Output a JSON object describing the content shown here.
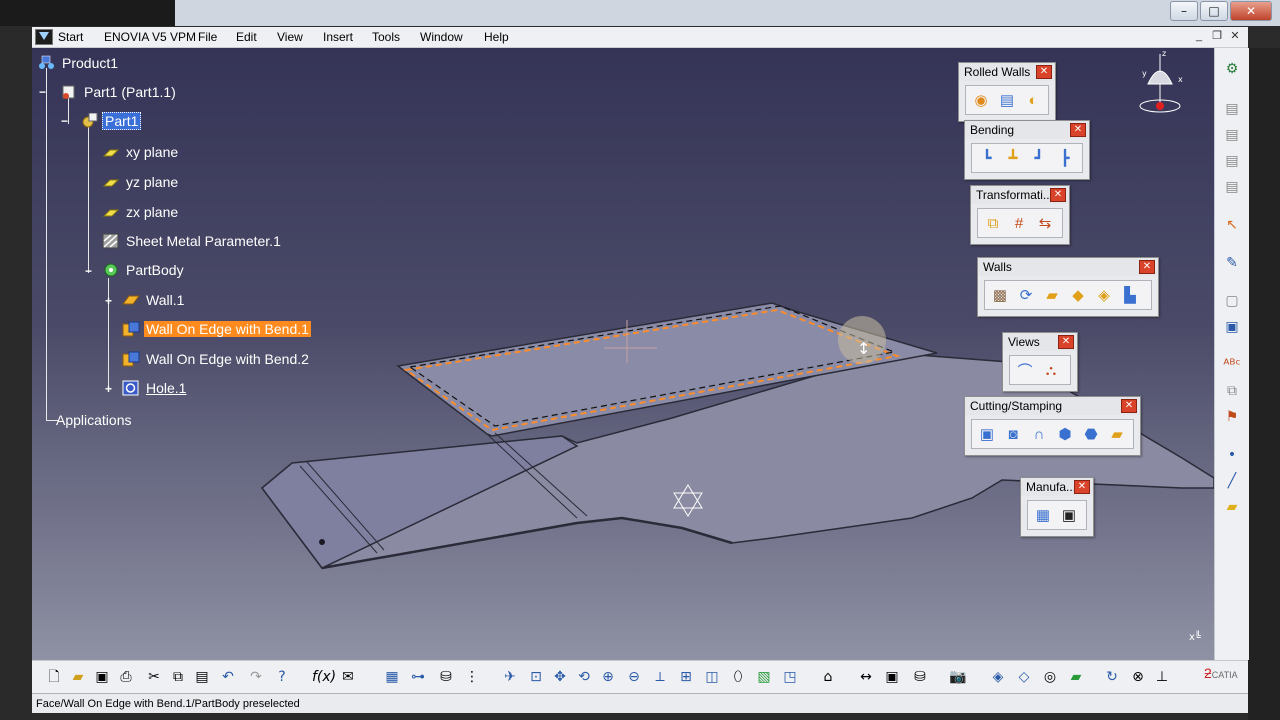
{
  "menubar": {
    "items": [
      "Start",
      "ENOVIA V5 VPM",
      "File",
      "Edit",
      "View",
      "Insert",
      "Tools",
      "Window",
      "Help"
    ]
  },
  "tree": {
    "product": "Product1",
    "part_instance": "Part1 (Part1.1)",
    "part": "Part1",
    "xy_plane": "xy plane",
    "yz_plane": "yz plane",
    "zx_plane": "zx plane",
    "sheet_metal_param": "Sheet Metal Parameter.1",
    "partbody": "PartBody",
    "wall1": "Wall.1",
    "wall_edge1": "Wall On Edge with Bend.1",
    "wall_edge2": "Wall On Edge with Bend.2",
    "hole1": "Hole.1",
    "applications": "Applications"
  },
  "panels": {
    "rolled_walls": "Rolled Walls",
    "bending": "Bending",
    "transformations": "Transformati...",
    "walls": "Walls",
    "views": "Views",
    "cutting": "Cutting/Stamping",
    "manufacturing": "Manufa..."
  },
  "compass": {
    "x": "x",
    "y": "y",
    "z": "z"
  },
  "axis_label": "x",
  "status_text": "Face/Wall On Edge with Bend.1/PartBody preselected",
  "logo_text": "CATIA",
  "colors": {
    "selection": "#ff8a1e",
    "highlight": "#ff8c2a",
    "panel_close": "#d9432a"
  }
}
